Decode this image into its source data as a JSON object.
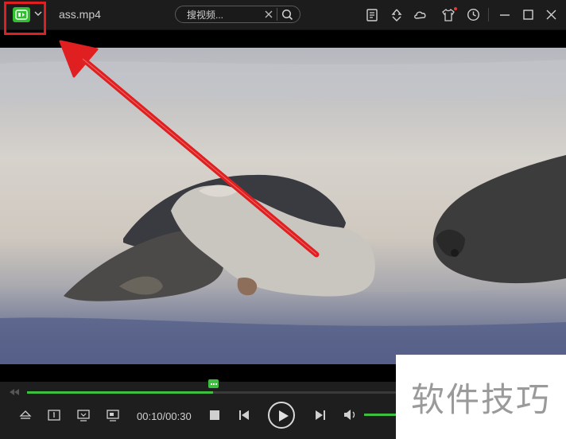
{
  "app": {
    "file_name": "ass.mp4",
    "logo_icon": "player-logo-icon"
  },
  "search": {
    "placeholder": "搜视频..."
  },
  "playback": {
    "time_display": "00:10/00:30",
    "progress_fraction": 0.5,
    "volume_fraction": 1.0
  },
  "watermark": {
    "text": "软件技巧"
  },
  "colors": {
    "accent": "#3fbf3f",
    "highlight_box": "#e02020",
    "annotation_arrow": "#e02020",
    "notification_dot": "#e43a3a"
  },
  "icons": {
    "titlebar": [
      "playlist-icon",
      "recycle-icon",
      "cloud-icon",
      "skin-icon",
      "history-icon",
      "minimize-icon",
      "maximize-icon",
      "close-icon"
    ],
    "controls": [
      "rewind-icon",
      "eject-icon",
      "subtitle-icon",
      "screenshot-icon",
      "picture-in-picture-icon",
      "stop-icon",
      "previous-icon",
      "play-icon",
      "next-icon",
      "volume-icon"
    ]
  }
}
